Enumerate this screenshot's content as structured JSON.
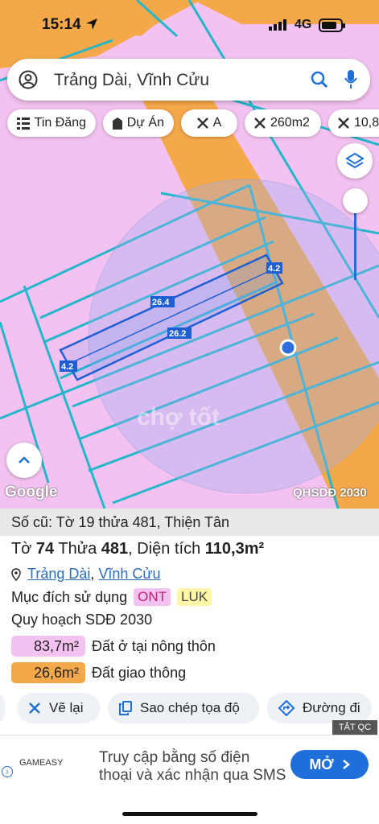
{
  "status": {
    "time": "15:14",
    "network": "4G"
  },
  "search": {
    "text": "Trảng Dài, Vĩnh Cửu"
  },
  "filters": [
    {
      "label": "Tin Đăng",
      "icon": "list-icon"
    },
    {
      "label": "Dự Án",
      "icon": "building-icon"
    },
    {
      "label": "A",
      "icon": "cross-icon"
    },
    {
      "label": "260m2",
      "icon": "cross-icon"
    },
    {
      "label": "10,8",
      "icon": "cross-icon"
    }
  ],
  "map": {
    "dims": [
      "4.2",
      "26.4",
      "26.2",
      "4.2"
    ],
    "provider": "Google",
    "layer_badge": "QHSDĐ 2030",
    "colors": {
      "residential": "#f4c2f0",
      "road": "#f5a84a",
      "parcel_line": "#23b7c9",
      "selection": "#1f5fd4"
    }
  },
  "panel": {
    "old_info": "Số cũ: Tờ 19 thửa 481, Thiện Tân",
    "parcel": {
      "sheet_label": "Tờ",
      "sheet": "74",
      "plot_label": "Thửa",
      "plot": "481",
      "area_label": "Diện tích",
      "area": "110,3m²"
    },
    "location": {
      "ward": "Trảng Dài",
      "sep": ",",
      "district": "Vĩnh Cửu"
    },
    "purpose_label": "Mục đích sử dụng",
    "purpose_tags": [
      "ONT",
      "LUK"
    ],
    "plan_label": "Quy hoạch SDĐ 2030",
    "areas": [
      {
        "value": "83,7m²",
        "label": "Đất ở tại nông thôn",
        "color": "#f4c2f0"
      },
      {
        "value": "26,6m²",
        "label": "Đất giao thông",
        "color": "#f5a84a"
      }
    ],
    "actions": [
      {
        "label": "Vẽ lại",
        "icon": "redraw-icon"
      },
      {
        "label": "Sao chép tọa độ",
        "icon": "copy-icon"
      },
      {
        "label": "Đường đi",
        "icon": "directions-icon"
      }
    ]
  },
  "ad": {
    "badge": "TẮT QC",
    "brand": "GAMEASY",
    "line1": "Truy cập bằng số điện",
    "line2": "thoại và xác nhận qua SMS",
    "button": "MỞ"
  }
}
